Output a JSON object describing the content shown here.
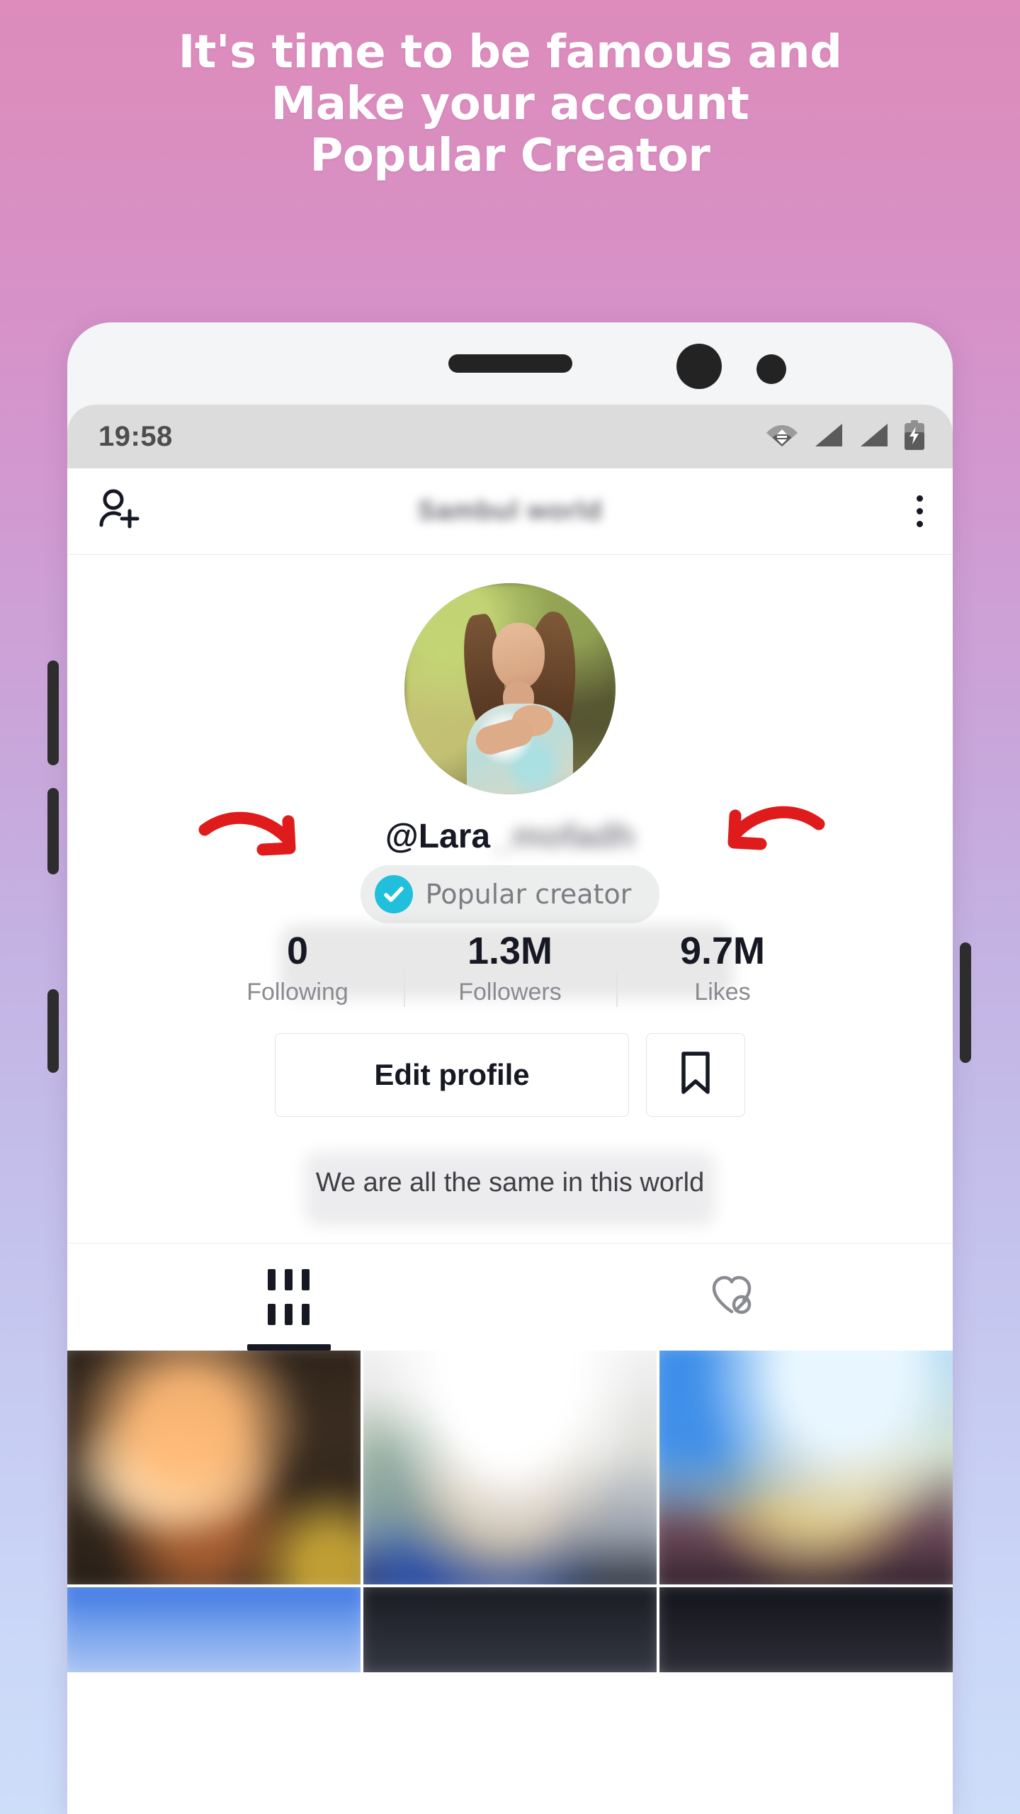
{
  "headline": {
    "lines": [
      "It's time to be famous and",
      "Make your account",
      "Popular Creator"
    ]
  },
  "colors": {
    "background_top": "#dd8cbb",
    "background_bottom": "#cddef9",
    "headline_text": "#ffffff",
    "verified_badge": "#20c0dc",
    "arrow_red": "#e01b1b",
    "text_primary": "#161823",
    "text_secondary": "#8a8b91",
    "screen_background": "#ffffff",
    "statusbar_background": "#dcdcdc"
  },
  "phone": {
    "status_bar": {
      "time": "19:58",
      "icons": [
        "wifi-icon",
        "signal-icon",
        "signal-icon",
        "battery-charging-icon"
      ]
    },
    "top_bar": {
      "add_person_icon": "add-person-icon",
      "title": "Sambul world",
      "title_blurred": true,
      "menu_icon": "three-dots-menu-icon"
    },
    "profile": {
      "avatar_alt": "profile-photo",
      "username_visible": "@Lara",
      "username_blurred_suffix": "_mofadh",
      "badge": {
        "icon": "verified-check-icon",
        "label": "Popular creator"
      },
      "stats": [
        {
          "value": "0",
          "label": "Following"
        },
        {
          "value": "1.3M",
          "label": "Followers"
        },
        {
          "value": "9.7M",
          "label": "Likes"
        }
      ],
      "edit_profile_label": "Edit profile",
      "bookmark_icon": "bookmark-icon",
      "bio": "We are all the same in this world"
    },
    "tabs": [
      {
        "icon": "grid-icon",
        "active": true
      },
      {
        "icon": "hidden-likes-heart-icon",
        "active": false
      }
    ],
    "video_grid": {
      "cells": [
        "video-thumbnail-1",
        "video-thumbnail-2",
        "video-thumbnail-3",
        "video-thumbnail-4",
        "video-thumbnail-5",
        "video-thumbnail-6"
      ]
    }
  },
  "annotations": {
    "arrows": [
      "arrow-pointing-to-username-left",
      "arrow-pointing-to-username-right"
    ]
  }
}
